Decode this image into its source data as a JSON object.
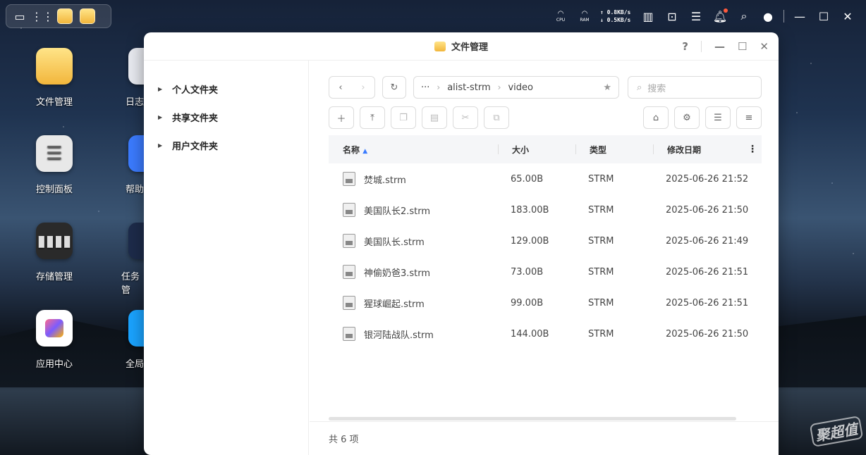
{
  "taskbar": {
    "net_up": "↑ 0.8KB/s",
    "net_down": "↓ 0.5KB/s",
    "cpu": "CPU",
    "ram": "RAM"
  },
  "desktop": {
    "icons": [
      "文件管理",
      "控制面板",
      "存储管理",
      "应用中心",
      "日志",
      "帮助",
      "任务管",
      "全局"
    ]
  },
  "window": {
    "title": "文件管理",
    "help": "?"
  },
  "sidebar": {
    "items": [
      "个人文件夹",
      "共享文件夹",
      "用户文件夹"
    ]
  },
  "path": {
    "ellipsis": "···",
    "segments": [
      "alist-strm",
      "video"
    ]
  },
  "search": {
    "placeholder": "搜索"
  },
  "table": {
    "headers": [
      "名称",
      "大小",
      "类型",
      "修改日期"
    ],
    "rows": [
      {
        "name": "焚城.strm",
        "size": "65.00B",
        "type": "STRM",
        "date": "2025-06-26 21:52"
      },
      {
        "name": "美国队长2.strm",
        "size": "183.00B",
        "type": "STRM",
        "date": "2025-06-26 21:50"
      },
      {
        "name": "美国队长.strm",
        "size": "129.00B",
        "type": "STRM",
        "date": "2025-06-26 21:49"
      },
      {
        "name": "神偷奶爸3.strm",
        "size": "73.00B",
        "type": "STRM",
        "date": "2025-06-26 21:51"
      },
      {
        "name": "猩球崛起.strm",
        "size": "99.00B",
        "type": "STRM",
        "date": "2025-06-26 21:51"
      },
      {
        "name": "银河陆战队.strm",
        "size": "144.00B",
        "type": "STRM",
        "date": "2025-06-26 21:50"
      }
    ]
  },
  "footer": {
    "count": "共 6 项"
  },
  "watermark": "聚超值"
}
